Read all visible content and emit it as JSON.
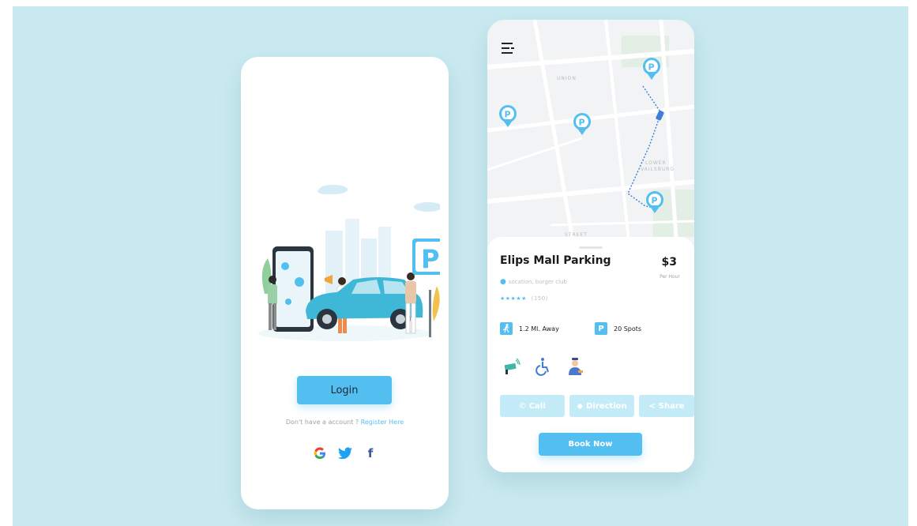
{
  "colors": {
    "backdrop": "#c9eaf0",
    "accent": "#53bff0",
    "accent_light": "#c4ebf8",
    "text_dark": "#1b1b1b",
    "text_muted": "#9aa3a8"
  },
  "login_screen": {
    "login_label": "Login",
    "register_prompt": "Don't have a account ?",
    "register_link": "Register Here",
    "social_icons": [
      "google-icon",
      "twitter-icon",
      "facebook-icon"
    ],
    "social_glyphs": {
      "google": "G",
      "twitter": "🐦",
      "facebook": "f"
    }
  },
  "map_screen": {
    "map_labels": {
      "union": "UNION",
      "lower_vailsburg_1": "LOWER",
      "lower_vailsburg_2": "VAILSBURG",
      "street": "STREET"
    },
    "parking": {
      "title": "Elips Mall Parking",
      "price": "$3",
      "price_unit": "Per Hour",
      "location": "socation, burger club",
      "stars": "★★★★★",
      "rating_count": "(150)",
      "distance": "1.2 Ml. Away",
      "spots": "20 Spots"
    },
    "amenities": [
      "cctv-camera-icon",
      "wheelchair-accessible-icon",
      "security-guard-icon"
    ],
    "actions": {
      "call": "Call",
      "direction": "Direction",
      "share": "Share"
    },
    "book_label": "Book Now"
  }
}
